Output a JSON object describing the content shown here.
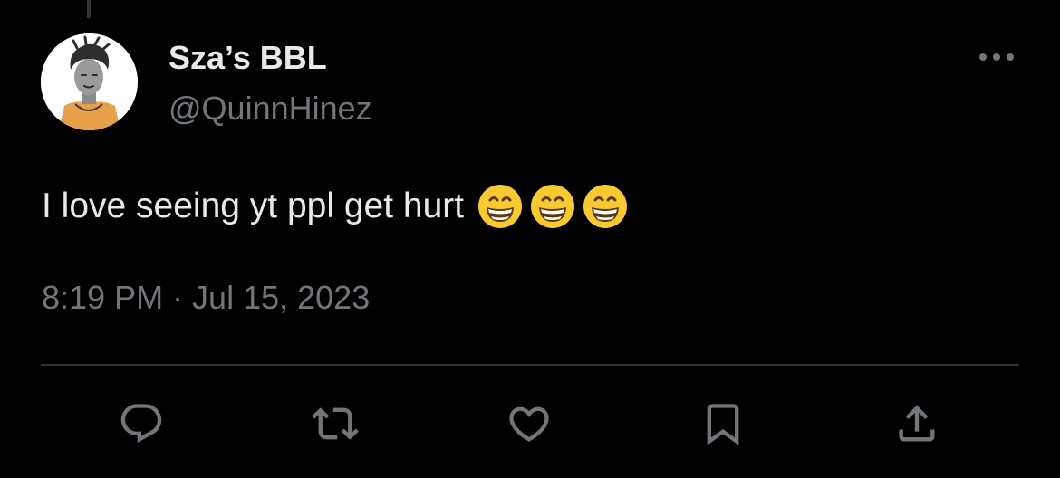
{
  "tweet": {
    "author": {
      "display_name": "Sza’s BBL",
      "handle": "@QuinnHinez"
    },
    "text": "I love seeing yt ppl get hurt",
    "emojis": [
      "grinning-face-with-smiling-eyes",
      "grinning-face-with-smiling-eyes",
      "grinning-face-with-smiling-eyes"
    ],
    "timestamp": "8:19 PM · Jul 15, 2023"
  },
  "actions": {
    "reply_icon": "reply-icon",
    "retweet_icon": "retweet-icon",
    "like_icon": "heart-icon",
    "bookmark_icon": "bookmark-icon",
    "share_icon": "share-icon"
  },
  "colors": {
    "background": "#000000",
    "primary_text": "#e7e9ea",
    "secondary_text": "#71767b",
    "divider": "#2f3336",
    "emoji_face": "#f9c932"
  }
}
